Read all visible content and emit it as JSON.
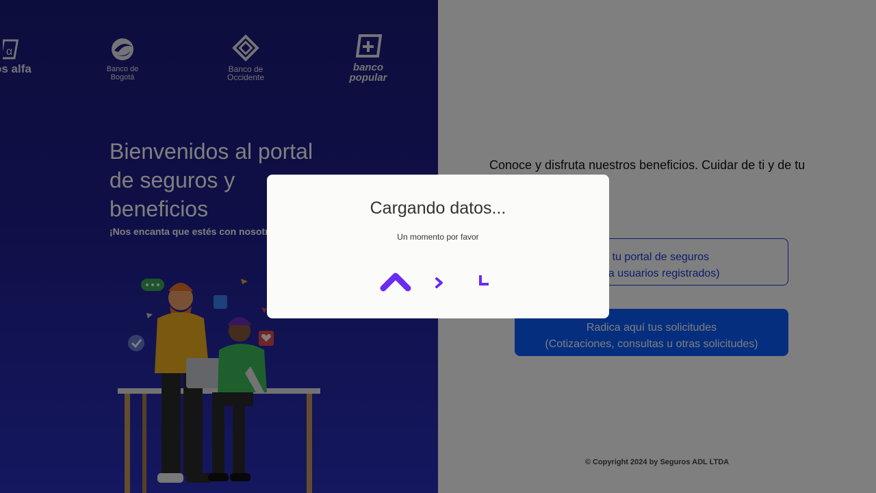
{
  "logos": {
    "alfa": "os alfa",
    "bogota": [
      "Banco de",
      "Bogotá"
    ],
    "occidente": [
      "Banco de",
      "Occidente"
    ],
    "popular": [
      "banco",
      "popular"
    ]
  },
  "welcome": {
    "title_lines": [
      "Bienvenidos al portal",
      "de seguros y",
      "beneficios"
    ],
    "subtitle": "¡Nos encanta que estés con nosotr"
  },
  "right": {
    "tagline": "Conoce y disfruta nuestros beneficios. Cuidar de ti y de tu",
    "portal_button": [
      "a a tu portal de seguros",
      "e para usuarios registrados)"
    ],
    "solicitudes_button": [
      "Radica aquí tus solicitudes",
      "(Cotizaciones, consultas u otras solicitudes)"
    ],
    "copyright": "© Copyright 2024 by Seguros ADL LTDA"
  },
  "modal": {
    "title": "Cargando datos...",
    "subtitle": "Un momento por favor"
  },
  "colors": {
    "left_bg": "#1f1f8f",
    "primary_button": "#0a5cff",
    "outline_button": "#1a3bd6",
    "loader": "#6a2cf0"
  },
  "icons": [
    "banco-de-bogota-logo",
    "banco-de-occidente-logo",
    "banco-popular-logo",
    "aval-alfa-logo",
    "loader-chevron-icon"
  ]
}
